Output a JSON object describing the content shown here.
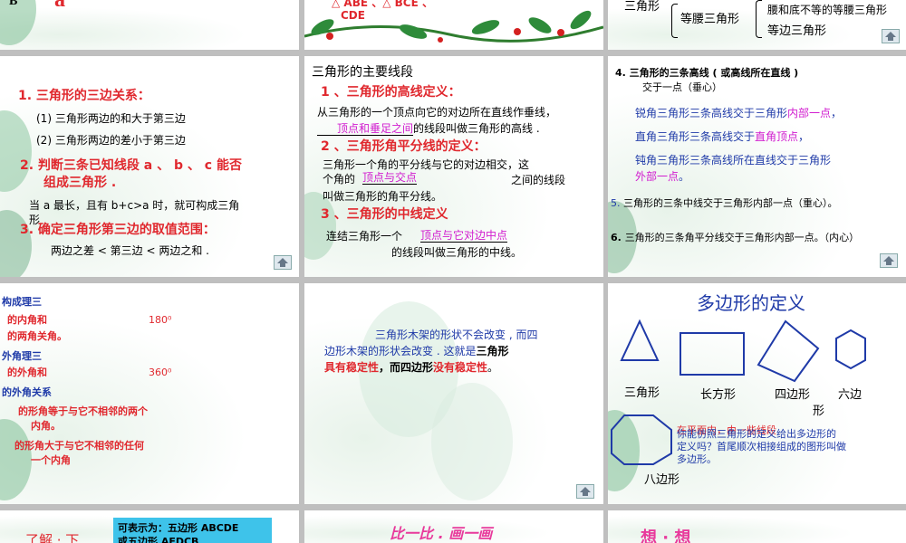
{
  "s1": {
    "b": "B",
    "a": "a"
  },
  "s2": {
    "line1": "△ ABE 、△ BCE 、",
    "line2": "CDE"
  },
  "s3": {
    "l1": "三角形",
    "l2": "等腰三角形",
    "l3": "腰和底不等的等腰三角形",
    "l4": "等边三角形"
  },
  "s4": {
    "title": "1. 三角形的三边关系：",
    "i1": "(1)  三角形两边的和大于第三边",
    "i2": "(2)  三角形两边的差小于第三边",
    "q2a": "2. 判断三条已知线段 a 、 b 、 c 能否",
    "q2b": "组成三角形 .",
    "note": "当 a 最长，且有 b+c>a 时，就可构成三角",
    "note2": "形",
    "q3": "3. 确定三角形第三边的取值范围：",
    "range": "两边之差 < 第三边 < 两边之和 ."
  },
  "s5": {
    "heading": "三角形的主要线段",
    "h1": "1 、三角形的高线定义：",
    "d1a": "从三角形的一个顶点向它的对边所在直线作垂线，",
    "fill1": "顶点和垂足之间",
    "d1b": "的线段叫做三角形的高线 .",
    "h2": "2 、三角形角平分线的定义：",
    "d2a": "三角形一个角的平分线与它的对边相交，这",
    "d2b": "个角的",
    "fill2": "顶点与交点",
    "d2c": "之间的线段",
    "d2d": "叫做三角形的角平分线。",
    "h3": "3 、三角形的中线定义",
    "d3a": "连结三角形一个",
    "fill3": "顶点与它对边中点",
    "d3b": "的线段叫做三角形的中线。"
  },
  "s6": {
    "p4a": "4.  三角形的三条高线 ( 或高线所在直线 )",
    "p4b": "交于一点（垂心）",
    "acute": "锐角三角形三条高线交于三角形",
    "acuteHl": "内部一点",
    "acuteEnd": "，",
    "right": "直角三角形三条高线交于",
    "rightHl": "直角顶点",
    "rightEnd": "，",
    "obtuse": "钝角三角形三条高线所在直线交于三角形",
    "obtuseHl": "外部一点",
    "obtuseEnd": "。",
    "p5num": "5.",
    "p5": "三角形的三条中线交于三角形内部一点（重心）。",
    "p6num": "6.",
    "p6": "三角形的三条角平分线交于三角形内部一点。（内心）"
  },
  "s7": {
    "a1": "构成理三",
    "a2": "的内角和",
    "a2v": "180⁰",
    "a3": "的两角关角。",
    "b1": "外角理三",
    "b2": "的外角和",
    "b2v": "360⁰",
    "b3": "的外角关系",
    "c1": "的形角等于与它不相邻的两个",
    "c2": "内角。",
    "d1": "的形角大于与它不相邻的任何",
    "d2": "一个内角"
  },
  "s8": {
    "t1": "三角形木架的形状不会改变 , 而四",
    "t2a": "边形木架的形状会改变 . 这就是",
    "t2b": "三角形",
    "t3a": "具有稳定性",
    "t3b": "，而四边形",
    "t3c": "没有稳定性",
    "t3d": "。"
  },
  "s9": {
    "title": "多边形的定义",
    "triangle": "三角形",
    "rect": "长方形",
    "quad": "四边形",
    "hex": "六边",
    "hex2": "形",
    "oct": "八边形",
    "def1": "你能仿照三角形的定义给出多边形的",
    "def2": "定义吗？首尾顺次相接组成的图形叫做",
    "def3": "多边形。",
    "defRed": "在平面内，由一些线段"
  },
  "s10": {
    "left": "了解 · 下",
    "box1": "可表示为：五边形 ABCDE",
    "box2": "或五边形 AEDCB"
  },
  "s11": {
    "title": "比一比 . 画一画"
  },
  "s12": {
    "title": "想 · 想"
  },
  "colors": {
    "red": "#e0282e",
    "magenta": "#d11ccf",
    "blue": "#1f3aa8",
    "shape": "#1f3aa8"
  }
}
